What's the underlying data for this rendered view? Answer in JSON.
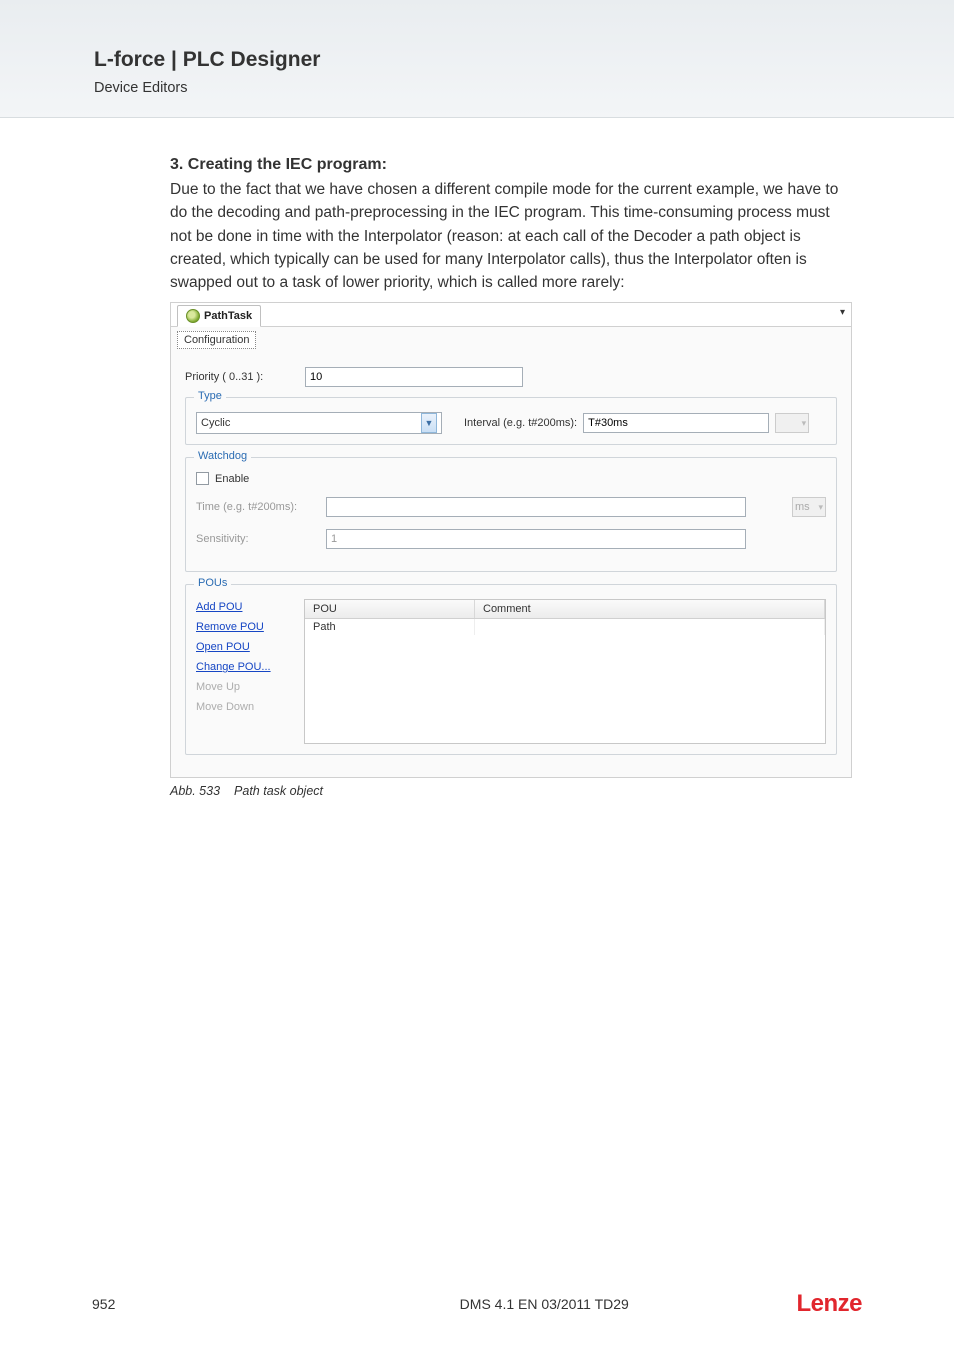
{
  "header": {
    "product": "L-force | PLC Designer",
    "section": "Device Editors"
  },
  "content": {
    "heading": "3. Creating the IEC program:",
    "paragraph": "Due to the fact that we have chosen a different compile mode for the current example, we have to do the decoding and path-preprocessing in the IEC program. This time-consuming process must not be done in time with the Interpolator  (reason: at each call of the Decoder a path object is created, which typically can be used for many Interpolator calls), thus the Interpolator often is swapped out to a task of lower priority, which is called more rarely:"
  },
  "task": {
    "tab_label": "PathTask",
    "config_tab": "Configuration",
    "priority_label": "Priority ( 0..31 ):",
    "priority_value": "10",
    "type_legend": "Type",
    "type_value": "Cyclic",
    "interval_label": "Interval (e.g. t#200ms):",
    "interval_value": "T#30ms",
    "watchdog_legend": "Watchdog",
    "enable_label": "Enable",
    "time_label": "Time (e.g. t#200ms):",
    "time_unit": "ms",
    "sensitivity_label": "Sensitivity:",
    "sensitivity_value": "1",
    "pous_legend": "POUs",
    "links": {
      "add": "Add POU",
      "remove": "Remove POU",
      "open": "Open POU",
      "change": "Change POU...",
      "moveup": "Move Up",
      "movedown": "Move Down"
    },
    "table": {
      "col_pou": "POU",
      "col_comment": "Comment",
      "rows": [
        {
          "pou": "Path",
          "comment": ""
        }
      ]
    }
  },
  "caption": {
    "fig": "Abb. 533",
    "text": "Path task object"
  },
  "footer": {
    "page": "952",
    "dms": "DMS 4.1 EN 03/2011 TD29",
    "logo": "Lenze"
  }
}
